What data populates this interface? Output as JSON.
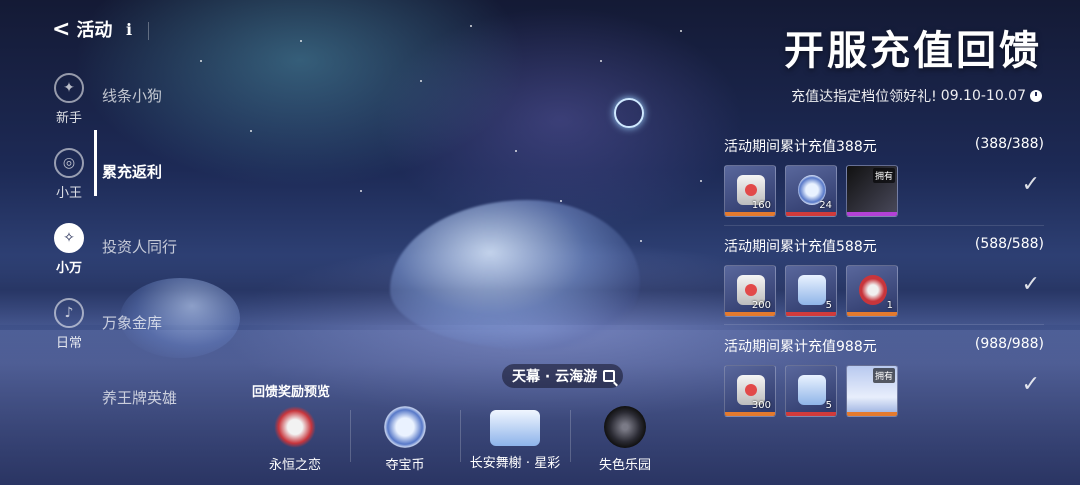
{
  "header": {
    "back_label": "活动",
    "info_label": "i"
  },
  "categories": [
    {
      "label": "新手",
      "icon": "compass-icon"
    },
    {
      "label": "小王",
      "icon": "target-icon"
    },
    {
      "label": "小万",
      "icon": "mascot-icon",
      "active": true
    },
    {
      "label": "日常",
      "icon": "bell-icon"
    }
  ],
  "subnav": [
    {
      "label": "线条小狗"
    },
    {
      "label": "累充返利",
      "active": true
    },
    {
      "label": "投资人同行"
    },
    {
      "label": "万象金库"
    },
    {
      "label": "养王牌英雄"
    }
  ],
  "banner": {
    "title": "开服充值回馈",
    "subtitle": "充值达指定档位领好礼!",
    "date_range": "09.10-10.07"
  },
  "tiers": [
    {
      "label": "活动期间累计充值388元",
      "progress": "(388/388)",
      "items": [
        {
          "type": "ticket",
          "qty": "160",
          "quality": "orange"
        },
        {
          "type": "coin",
          "qty": "24",
          "quality": "red"
        },
        {
          "type": "dark",
          "owned": "拥有",
          "quality": "purple"
        }
      ],
      "claimed": true
    },
    {
      "label": "活动期间累计充值588元",
      "progress": "(588/588)",
      "items": [
        {
          "type": "ticket",
          "qty": "200",
          "quality": "orange"
        },
        {
          "type": "box",
          "qty": "5",
          "quality": "red"
        },
        {
          "type": "heart",
          "qty": "1",
          "quality": "orange"
        }
      ],
      "claimed": true
    },
    {
      "label": "活动期间累计充值988元",
      "progress": "(988/988)",
      "items": [
        {
          "type": "ticket",
          "qty": "300",
          "quality": "orange"
        },
        {
          "type": "box",
          "qty": "5",
          "quality": "red"
        },
        {
          "type": "sky",
          "owned": "拥有",
          "quality": "orange"
        }
      ],
      "claimed": true
    }
  ],
  "check_glyph": "✓",
  "scene": {
    "label": "天幕 · 云海游"
  },
  "preview": {
    "title": "回馈奖励预览",
    "items": [
      {
        "name": "永恒之恋",
        "type": "heart"
      },
      {
        "name": "夺宝币",
        "type": "coin"
      },
      {
        "name": "长安舞榭 · 星彩",
        "type": "box"
      },
      {
        "name": "失色乐园",
        "type": "dark"
      }
    ]
  }
}
